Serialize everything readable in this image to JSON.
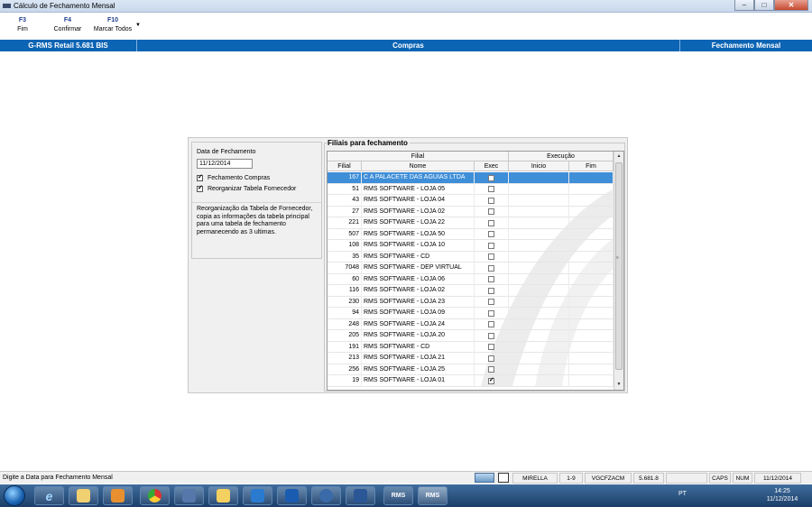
{
  "window": {
    "title": "Cálculo de Fechamento Mensal",
    "min": "–",
    "max": "□",
    "close": "✕"
  },
  "toolbar": {
    "buttons": [
      {
        "key": "F3",
        "label": "Fim"
      },
      {
        "key": "F4",
        "label": "Confirmar"
      },
      {
        "key": "F10",
        "label": "Marcar Todos"
      }
    ],
    "more": "▼"
  },
  "header": {
    "product": "G-RMS Retail 5.681 BIS",
    "module": "Compras",
    "screen": "Fechamento Mensal"
  },
  "form": {
    "date_label": "Data de Fechamento",
    "date_value": "11/12/2014",
    "chk_compras_label": "Fechamento Compras",
    "chk_compras_checked": true,
    "chk_reorg_label": "Reorganizar Tabela Fornecedor",
    "chk_reorg_checked": true,
    "description": "Reorganização da Tabela de Fornecedor, copia as informações da tabela principal para uma tabela de fechamento permanecendo as 3 ultimas."
  },
  "grid": {
    "group_title": "Filiais para fechamento",
    "header_filial": "Filial",
    "header_execucao": "Execução",
    "col_filial": "Filial",
    "col_nome": "Nome",
    "col_exec": "Exec",
    "col_inicio": "Inicio",
    "col_fim": "Fim",
    "rows": [
      {
        "filial": "167",
        "nome": "C A PALACETE DAS AGUIAS LTDA",
        "exec": false,
        "selected": true
      },
      {
        "filial": "51",
        "nome": "RMS SOFTWARE - LOJA 05",
        "exec": false
      },
      {
        "filial": "43",
        "nome": "RMS SOFTWARE - LOJA 04",
        "exec": false
      },
      {
        "filial": "27",
        "nome": "RMS SOFTWARE - LOJA 02",
        "exec": false
      },
      {
        "filial": "221",
        "nome": "RMS SOFTWARE - LOJA 22",
        "exec": false
      },
      {
        "filial": "507",
        "nome": "RMS SOFTWARE - LOJA 50",
        "exec": false
      },
      {
        "filial": "108",
        "nome": "RMS SOFTWARE - LOJA 10",
        "exec": false
      },
      {
        "filial": "35",
        "nome": "RMS SOFTWARE - CD",
        "exec": false
      },
      {
        "filial": "7048",
        "nome": "RMS SOFTWARE - DEP VIRTUAL",
        "exec": false
      },
      {
        "filial": "60",
        "nome": "RMS SOFTWARE - LOJA 06",
        "exec": false
      },
      {
        "filial": "116",
        "nome": "RMS SOFTWARE - LOJA 02",
        "exec": false
      },
      {
        "filial": "230",
        "nome": "RMS SOFTWARE - LOJA 23",
        "exec": false
      },
      {
        "filial": "94",
        "nome": "RMS SOFTWARE - LOJA 09",
        "exec": false
      },
      {
        "filial": "248",
        "nome": "RMS SOFTWARE - LOJA 24",
        "exec": false
      },
      {
        "filial": "205",
        "nome": "RMS SOFTWARE - LOJA 20",
        "exec": false
      },
      {
        "filial": "191",
        "nome": "RMS SOFTWARE  -  CD",
        "exec": false
      },
      {
        "filial": "213",
        "nome": "RMS SOFTWARE - LOJA 21",
        "exec": false
      },
      {
        "filial": "256",
        "nome": "RMS SOFTWARE - LOJA 25",
        "exec": false
      },
      {
        "filial": "19",
        "nome": "RMS SOFTWARE - LOJA 01",
        "exec": true
      }
    ],
    "scroll_up": "▲",
    "scroll_down": "▼",
    "scroll_grip": "≡"
  },
  "status": {
    "message": "Digite a Data para Fechamento Mensal",
    "user": "MIRELLA",
    "range": "1-9",
    "program": "VGCFZACM",
    "version": "5.681.8",
    "caps": "CAPS",
    "num": "NUM",
    "date": "11/12/2014"
  },
  "taskbar": {
    "items": [
      "e",
      "",
      "",
      "",
      "",
      "",
      "",
      "",
      "",
      "",
      "RMS",
      "RMS"
    ],
    "tray_lang": "PT",
    "clock_time": "14:25",
    "clock_date": "11/12/2014"
  },
  "colors": {
    "header_blue": "#0c64b4",
    "selection_blue": "#3e8ed8",
    "shortcut_key": "#1f3f8f"
  }
}
